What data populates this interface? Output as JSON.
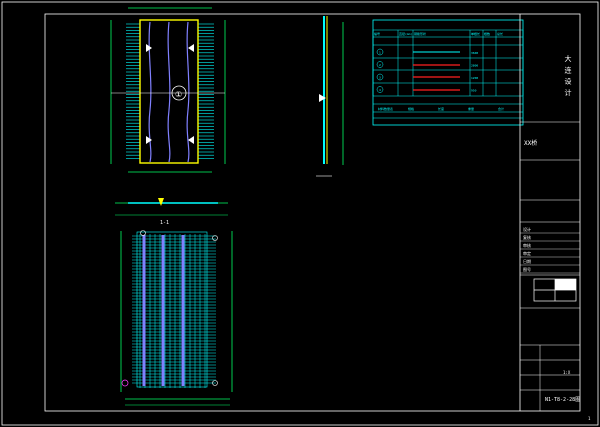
{
  "colors": {
    "background": "#000000",
    "frame": "#ffffff",
    "rebar": "#00ffff",
    "dim": "#00ff66",
    "outline": "#ffff00",
    "strand": "#8080ff",
    "stirrup": "#c0c0ff",
    "red": "#ff2020",
    "magenta": "#ff40ff"
  },
  "plan_view": {
    "marker": "①"
  },
  "section_label": "1-1",
  "title_block": {
    "company": "大 连 设 计",
    "project": "XX桥",
    "sheet_title": "N1-T8-2-28图",
    "rows": [
      "设计",
      "复核",
      "审核",
      "审定",
      "日期",
      "图号"
    ],
    "scale_label": "1:X",
    "page_number": "1"
  },
  "rebar_table": {
    "header": [
      "编号",
      "直径(mm)",
      "钢筋形状",
      "单根长",
      "根数",
      "总长"
    ],
    "rows": [
      {
        "id": "1",
        "len": "3600"
      },
      {
        "id": "2",
        "len": "2800"
      },
      {
        "id": "3",
        "len": "1200"
      },
      {
        "id": "4",
        "len": "950"
      }
    ],
    "summary": [
      "材料数量表",
      "规格",
      "长度",
      "重量",
      "合计"
    ]
  }
}
